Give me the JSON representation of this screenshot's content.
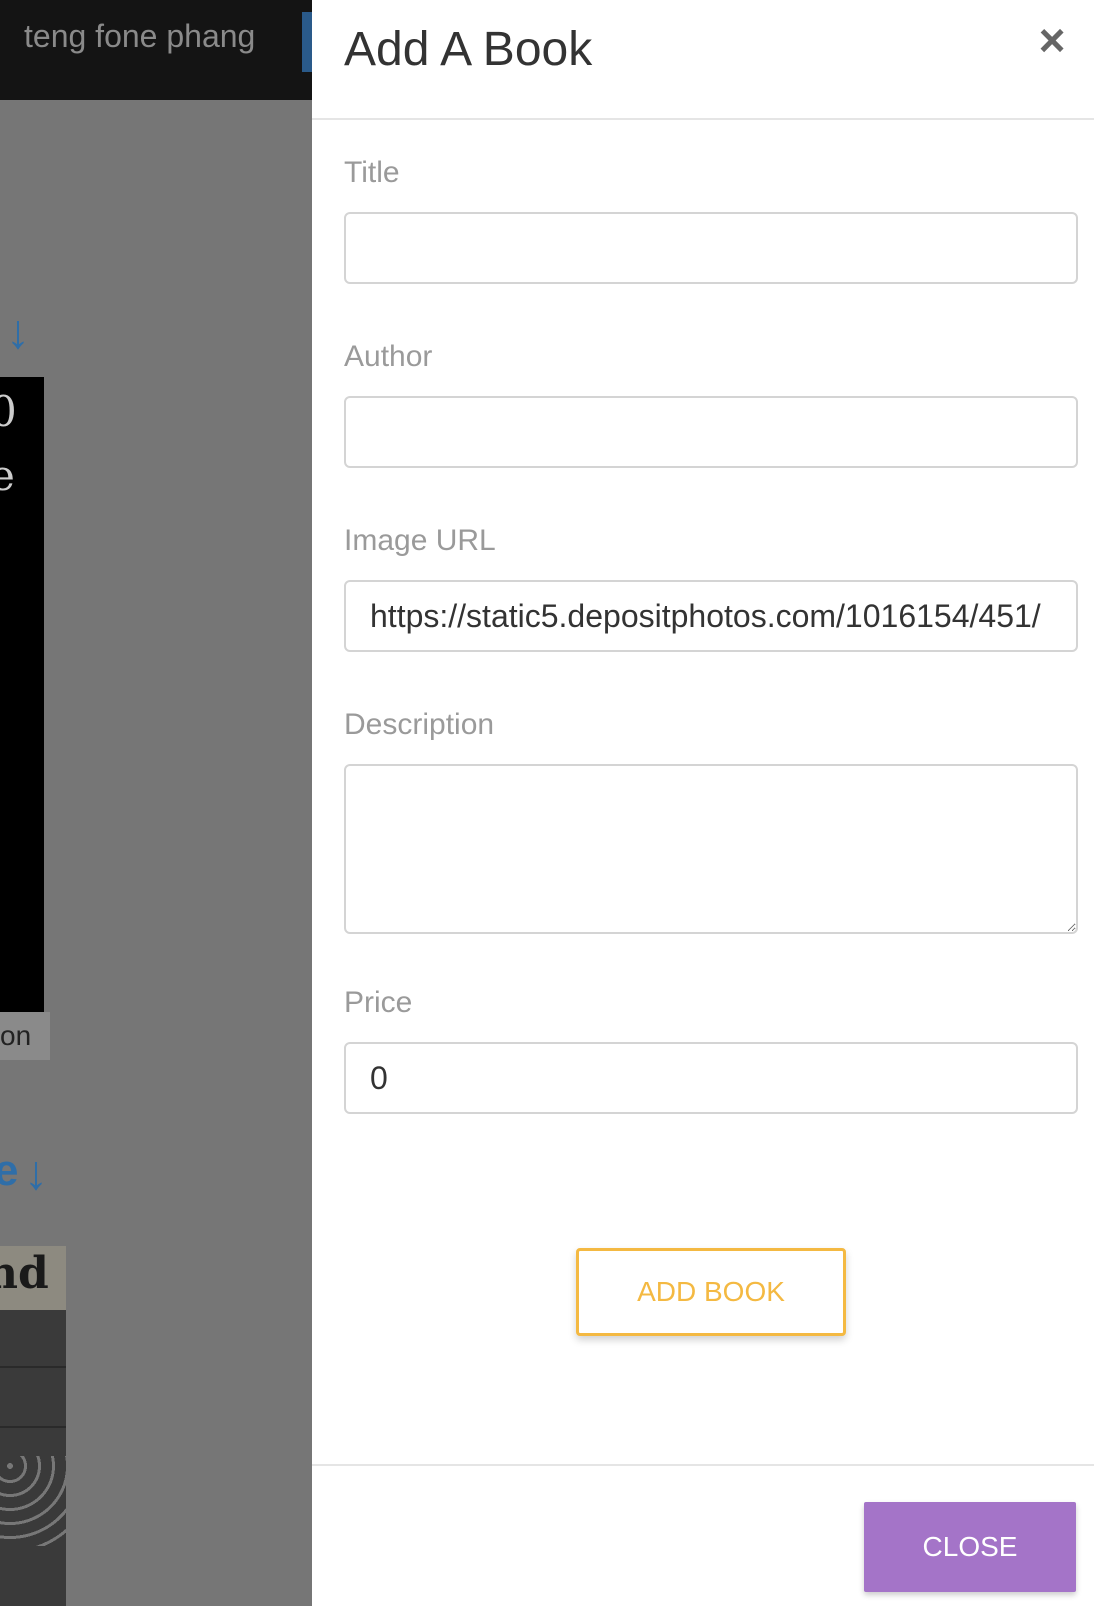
{
  "background": {
    "user_name": "teng fone phang",
    "arrow_glyph": "↓",
    "card_text_line1": "0",
    "card_text_line2": "e",
    "tag_text": "on",
    "photo_caption": "nd",
    "arrow2_prefix": "e"
  },
  "modal": {
    "title": "Add A Book",
    "close_icon": "close-icon",
    "close_glyph": "×",
    "fields": {
      "title": {
        "label": "Title",
        "value": ""
      },
      "author": {
        "label": "Author",
        "value": ""
      },
      "image_url": {
        "label": "Image URL",
        "value": "https://static5.depositphotos.com/1016154/451/"
      },
      "description": {
        "label": "Description",
        "value": ""
      },
      "price": {
        "label": "Price",
        "value": "0"
      }
    },
    "add_button_label": "ADD BOOK",
    "close_button_label": "CLOSE"
  },
  "colors": {
    "accent_orange": "#f4b942",
    "close_purple": "#a474c8",
    "backdrop": "#7a7a7a"
  }
}
